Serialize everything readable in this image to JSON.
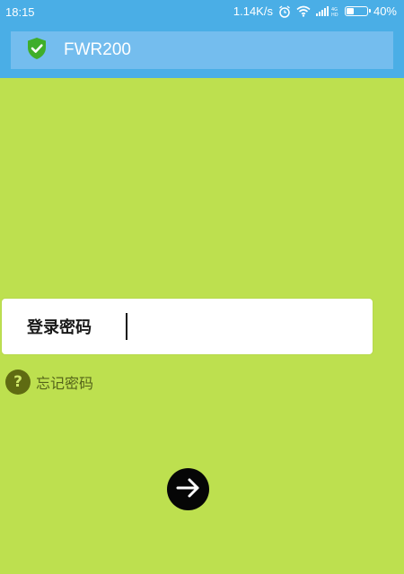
{
  "status_bar": {
    "time": "18:15",
    "network_speed": "1.14K/s",
    "alarm_icon": "alarm-icon",
    "wifi_icon": "wifi-icon",
    "signal_icon": "signal-icon",
    "battery_icon": "battery-icon",
    "battery_percent": "40%",
    "battery_level": 0.4
  },
  "header": {
    "shield_icon": "shield-check-icon",
    "device_name": "FWR200"
  },
  "login": {
    "password_label": "登录密码",
    "password_value": "",
    "forgot_icon": "question-icon",
    "forgot_icon_glyph": "?",
    "forgot_label": "忘记密码",
    "submit_icon": "arrow-right-icon"
  },
  "colors": {
    "background": "#bde04f",
    "header": "#4aaee6",
    "header_card": "#74bdee",
    "shield": "#3fae2a",
    "forgot_icon_bg": "#5f6b12",
    "submit_bg": "#060606"
  }
}
